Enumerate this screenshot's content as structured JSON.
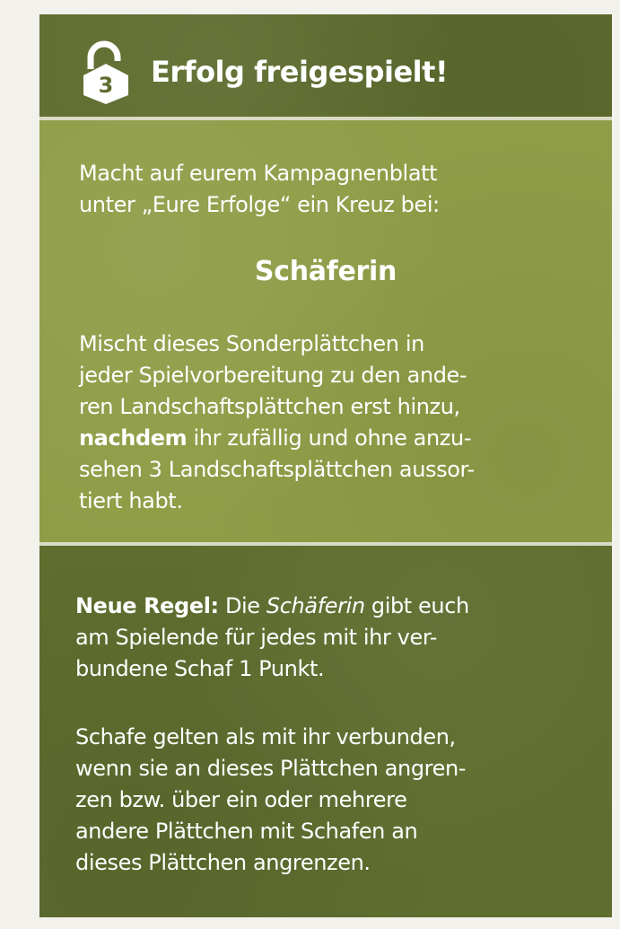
{
  "header": {
    "lock_number": "3",
    "title": "Erfolg freigespielt!"
  },
  "intro": {
    "line1": "Macht auf eurem Kampagnenblatt",
    "line2": "unter „Eure Erfolge“ ein Kreuz bei:"
  },
  "achievement": {
    "name": "Schäferin"
  },
  "setup": {
    "line1": "Mischt dieses Sonderplättchen in",
    "line2": "jeder Spielvorbereitung zu den ande-",
    "line3": "ren Landschaftsplättchen erst hinzu,",
    "line4_bold": "nachdem",
    "line4_rest": " ihr zufällig und ohne anzu-",
    "line5": "sehen 3 Landschaftsplättchen aussor-",
    "line6": "tiert habt."
  },
  "rule": {
    "label": "Neue Regel:",
    "line1_a": " Die ",
    "line1_italic": "Schäferin",
    "line1_b": " gibt euch",
    "line2": "am Spielende für jedes mit ihr ver-",
    "line3": "bundene Schaf 1 Punkt."
  },
  "connection": {
    "line1": "Schafe gelten als mit ihr verbunden,",
    "line2": "wenn sie an dieses Plättchen angren-",
    "line3": "zen bzw. über ein oder mehrere",
    "line4": "andere Plättchen mit Schafen an",
    "line5": "dieses Plättchen angrenzen."
  },
  "colors": {
    "header_green": "#5f6d2f",
    "middle_green": "#8f9d47",
    "divider": "#d9dbc6",
    "text": "#ffffff"
  },
  "icons": {
    "header_icon": "unlocked-padlock-icon"
  }
}
